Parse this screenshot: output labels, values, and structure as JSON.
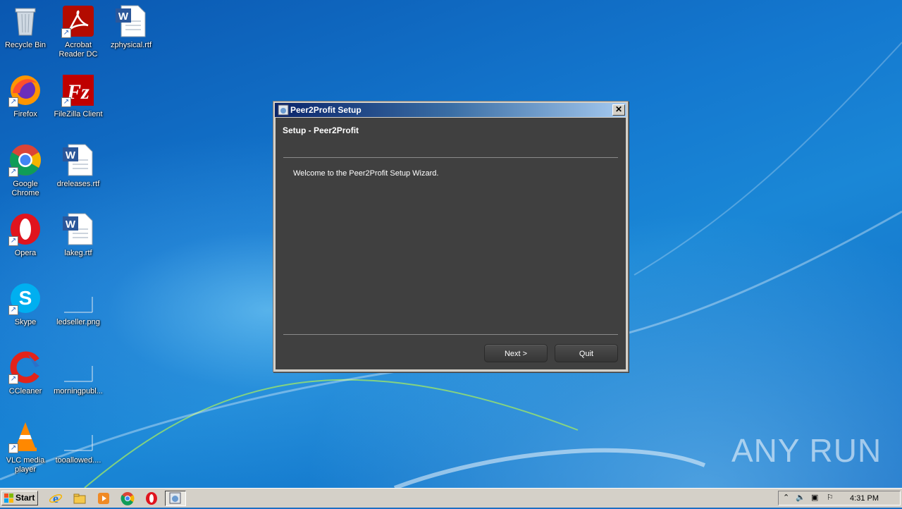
{
  "desktop_icons": [
    {
      "label": "Recycle Bin",
      "icon": "recycle-bin-icon"
    },
    {
      "label": "Acrobat Reader DC",
      "icon": "acrobat-icon"
    },
    {
      "label": "zphysical.rtf",
      "icon": "word-doc-icon"
    },
    {
      "label": "Firefox",
      "icon": "firefox-icon"
    },
    {
      "label": "FileZilla Client",
      "icon": "filezilla-icon"
    },
    {
      "label": "Google Chrome",
      "icon": "chrome-icon"
    },
    {
      "label": "dreleases.rtf",
      "icon": "word-doc-icon"
    },
    {
      "label": "Opera",
      "icon": "opera-icon"
    },
    {
      "label": "lakeg.rtf",
      "icon": "word-doc-icon"
    },
    {
      "label": "Skype",
      "icon": "skype-icon"
    },
    {
      "label": "ledseller.png",
      "icon": "image-file-icon"
    },
    {
      "label": "CCleaner",
      "icon": "ccleaner-icon"
    },
    {
      "label": "morningpubl...",
      "icon": "blank-file-icon"
    },
    {
      "label": "VLC media player",
      "icon": "vlc-icon"
    },
    {
      "label": "tooallowed....",
      "icon": "blank-file-icon"
    }
  ],
  "window": {
    "title": "Peer2Profit Setup",
    "heading": "Setup - Peer2Profit",
    "welcome": "Welcome to the Peer2Profit Setup Wizard.",
    "next_label": "Next >",
    "quit_label": "Quit",
    "close_glyph": "✕"
  },
  "watermark": "ANY RUN",
  "taskbar": {
    "start_label": "Start",
    "clock": "4:31 PM",
    "pinned": [
      "ie-icon",
      "explorer-icon",
      "media-player-icon",
      "chrome-icon",
      "opera-icon",
      "setup-icon"
    ]
  },
  "colors": {
    "dialog_bg": "#404040",
    "titlebar_start": "#0a246a",
    "titlebar_end": "#a6caf0",
    "desktop_blue": "#1478cf"
  }
}
